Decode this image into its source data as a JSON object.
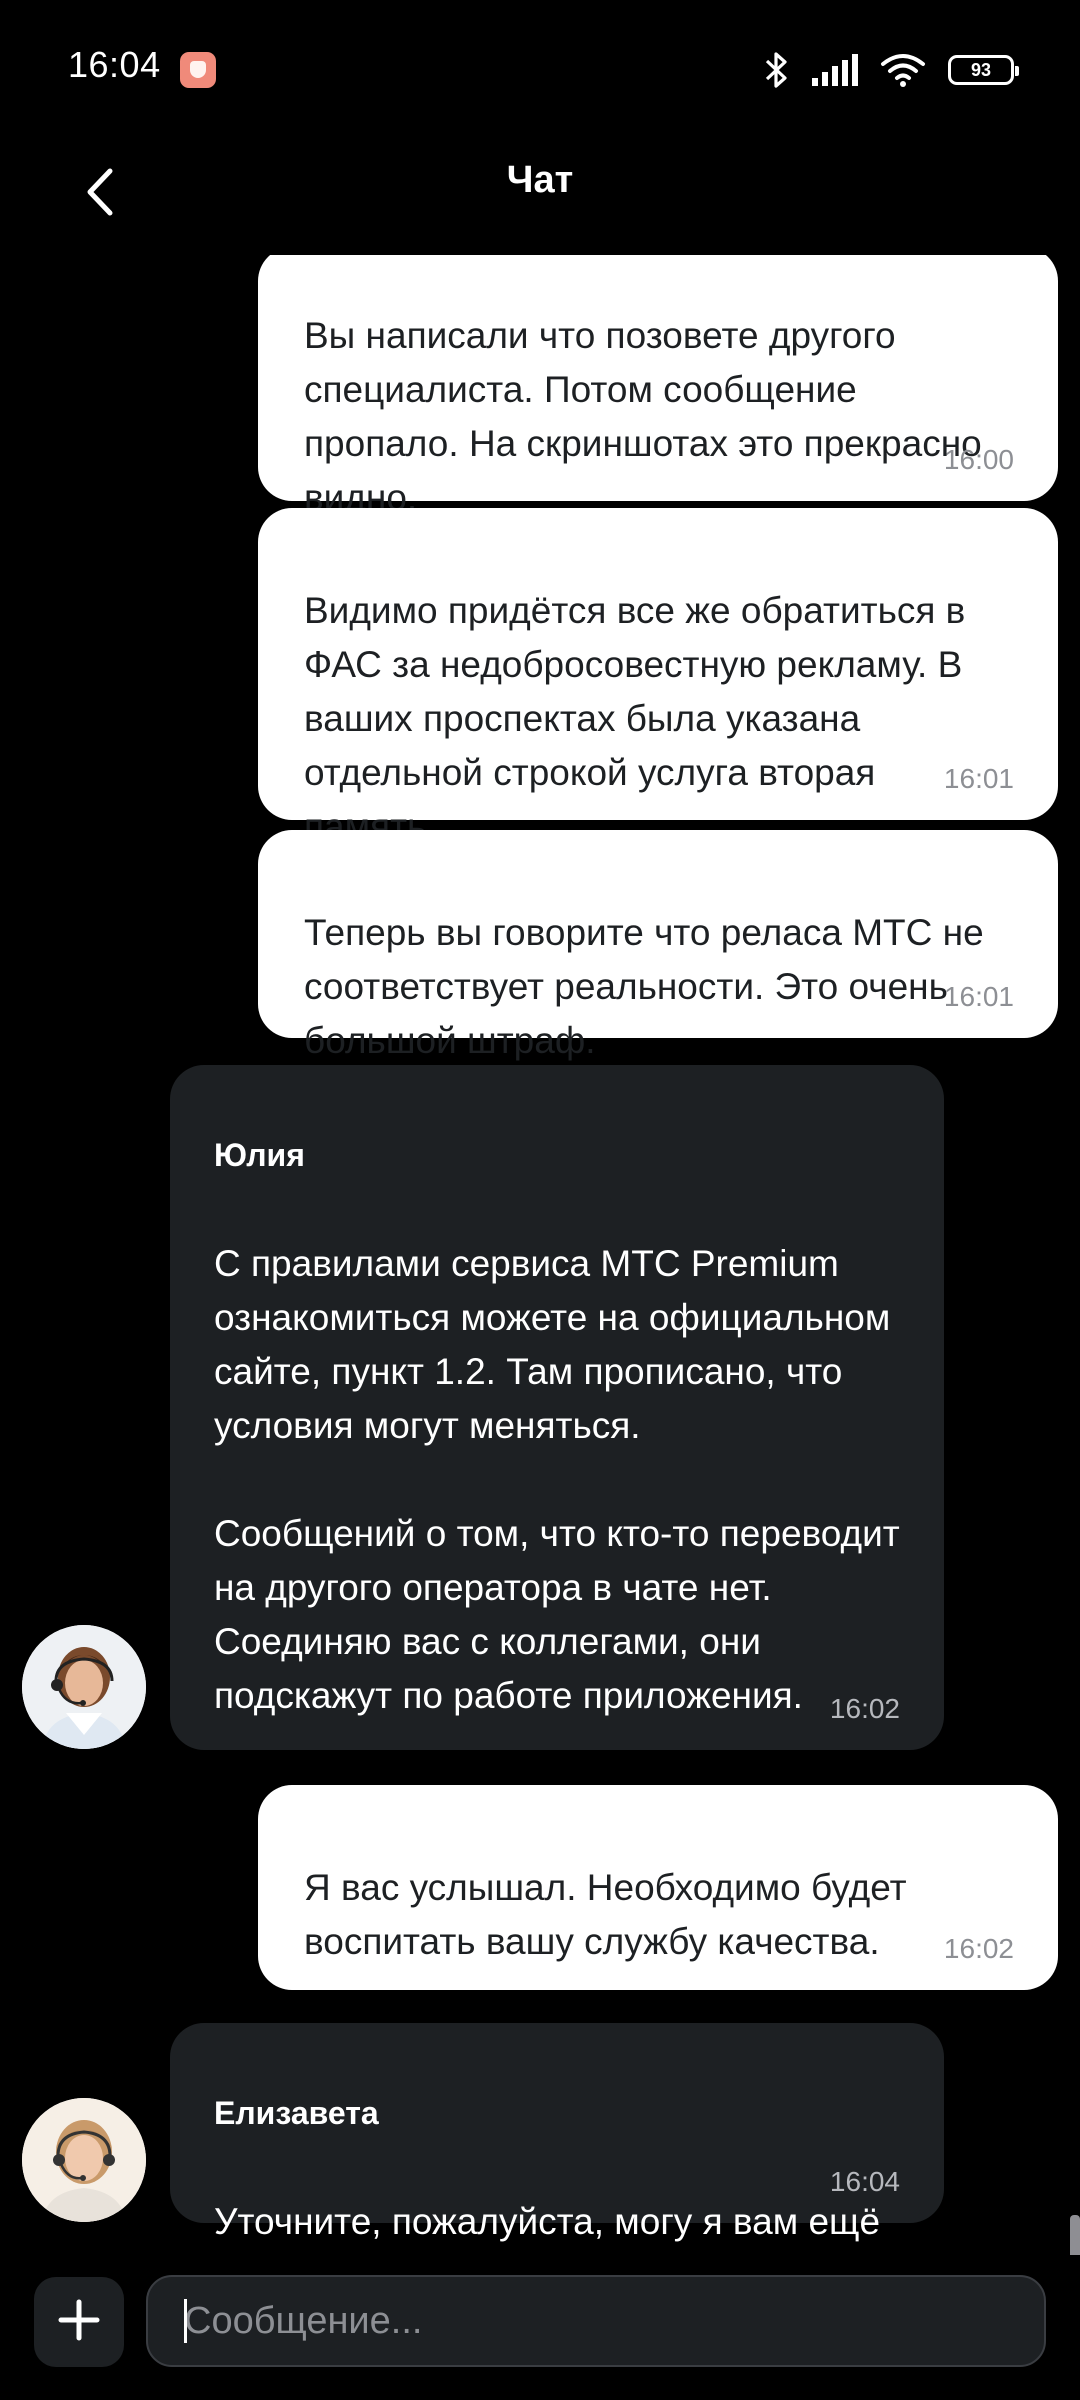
{
  "status_bar": {
    "time": "16:04",
    "battery": "93",
    "icons": [
      "notification-app-icon",
      "bluetooth-icon",
      "signal-icon",
      "wifi-icon",
      "battery-icon"
    ]
  },
  "header": {
    "title": "Чат",
    "back_icon": "chevron-left-icon"
  },
  "messages": [
    {
      "direction": "out",
      "text": "Вы написали что позовете другого специалиста. Потом сообщение пропало. На скриншотах это прекрасно видно.",
      "time": "16:00"
    },
    {
      "direction": "out",
      "text": "Видимо придётся все же обратиться в ФАС за недобросовестную рекламу. В ваших проспектах была указана отдельной строкой услуга вторая память.",
      "time": "16:01"
    },
    {
      "direction": "out",
      "text": "Теперь вы говорите что реласа МТС не соответствует реальности. Это очень большой штраф.",
      "time": "16:01"
    },
    {
      "direction": "in",
      "sender": "Юлия",
      "text": "С правилами сервиса МТС Premium ознакомиться можете на официальном сайте, пункт 1.2. Там прописано, что условия могут меняться.\n\nСообщений о том, что кто-то переводит на другого оператора в чате нет. Соединяю вас с коллегами, они подскажут по работе приложения.",
      "time": "16:02",
      "avatar": "operator-avatar"
    },
    {
      "direction": "out",
      "text": "Я вас услышал. Необходимо будет воспитать вашу службу качества.",
      "time": "16:02"
    },
    {
      "direction": "in",
      "sender": "Елизавета",
      "text": "Уточните, пожалуйста, могу я вам ещё что-нибудь подсказать?",
      "time": "16:04",
      "avatar": "operator-avatar"
    }
  ],
  "composer": {
    "add_icon": "plus-icon",
    "placeholder": "Сообщение...",
    "value": ""
  },
  "colors": {
    "background": "#000000",
    "outgoing_bubble": "#ffffff",
    "incoming_bubble": "#1d2023",
    "timestamp_out": "#8d8f94",
    "timestamp_in": "#b6b8bd"
  }
}
